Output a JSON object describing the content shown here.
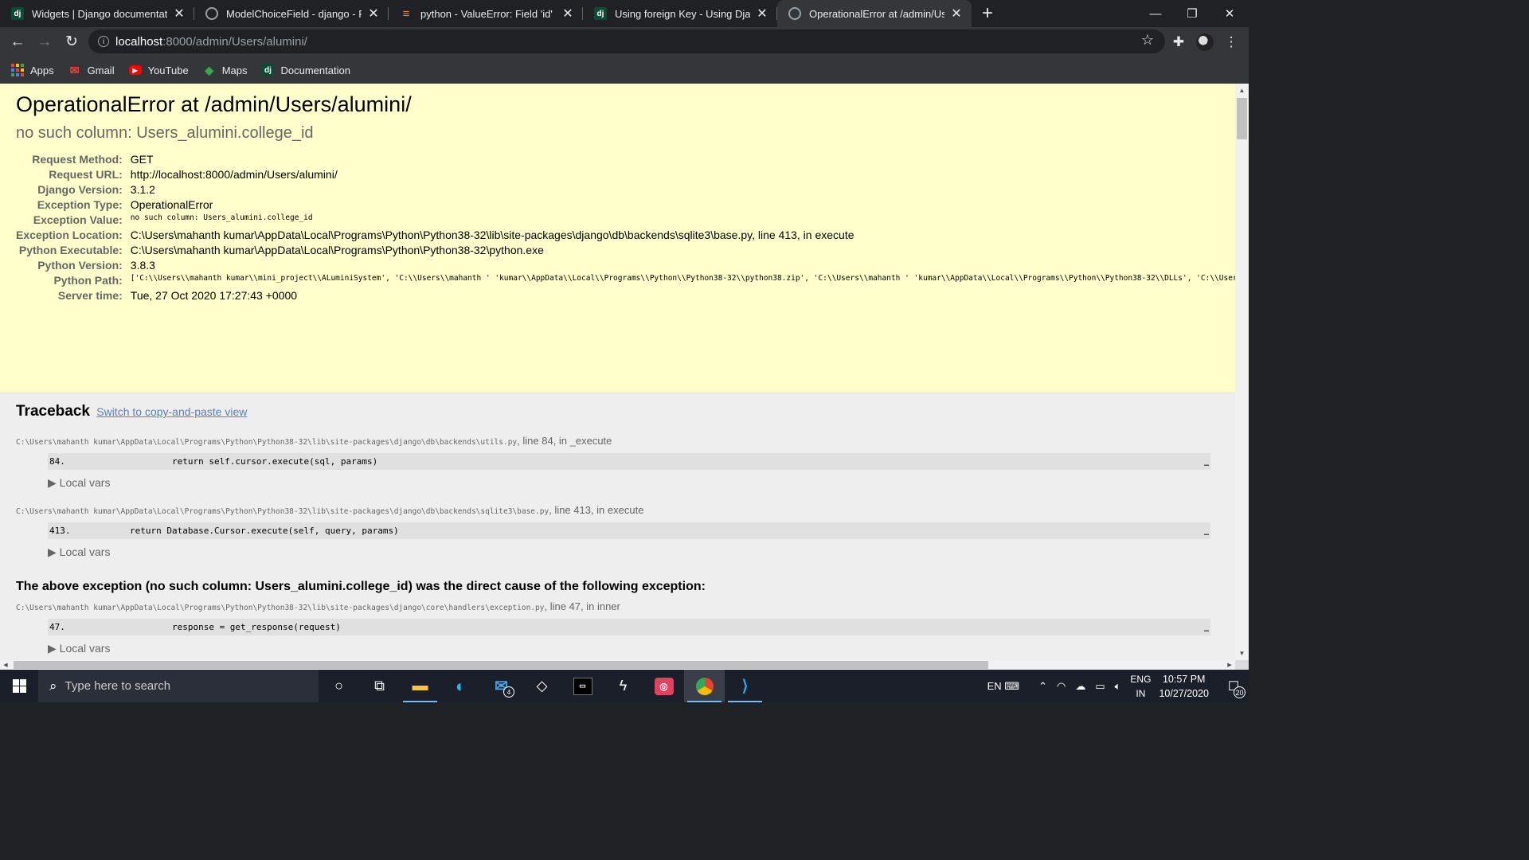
{
  "browser": {
    "tabs": [
      {
        "title": "Widgets | Django documentation",
        "icon": "django-icon"
      },
      {
        "title": "ModelChoiceField - django - Pyth",
        "icon": "globe-icon"
      },
      {
        "title": "python - ValueError: Field 'id' exp",
        "icon": "stackoverflow-icon"
      },
      {
        "title": "Using foreign Key - Using Django",
        "icon": "django-icon"
      },
      {
        "title": "OperationalError at /admin/Users",
        "icon": "globe-icon",
        "active": true
      }
    ],
    "url_host": "localhost",
    "url_path": ":8000/admin/Users/alumini/",
    "bookmarks": [
      "Apps",
      "Gmail",
      "YouTube",
      "Maps",
      "Documentation"
    ]
  },
  "error": {
    "title": "OperationalError at /admin/Users/alumini/",
    "subtitle": "no such column: Users_alumini.college_id",
    "meta": [
      {
        "label": "Request Method:",
        "value": "GET"
      },
      {
        "label": "Request URL:",
        "value": "http://localhost:8000/admin/Users/alumini/"
      },
      {
        "label": "Django Version:",
        "value": "3.1.2"
      },
      {
        "label": "Exception Type:",
        "value": "OperationalError"
      },
      {
        "label": "Exception Value:",
        "value": "no such column: Users_alumini.college_id"
      },
      {
        "label": "Exception Location:",
        "value": "C:\\Users\\mahanth kumar\\AppData\\Local\\Programs\\Python\\Python38-32\\lib\\site-packages\\django\\db\\backends\\sqlite3\\base.py, line 413, in execute"
      },
      {
        "label": "Python Executable:",
        "value": "C:\\Users\\mahanth kumar\\AppData\\Local\\Programs\\Python\\Python38-32\\python.exe"
      },
      {
        "label": "Python Version:",
        "value": "3.8.3"
      },
      {
        "label": "Python Path:",
        "value": "['C:\\\\Users\\\\mahanth kumar\\\\mini_project\\\\ALuminiSystem',\n 'C:\\\\Users\\\\mahanth '\n 'kumar\\\\AppData\\\\Local\\\\Programs\\\\Python\\\\Python38-32\\\\python38.zip',\n 'C:\\\\Users\\\\mahanth '\n 'kumar\\\\AppData\\\\Local\\\\Programs\\\\Python\\\\Python38-32\\\\DLLs',\n 'C:\\\\Users\\\\mahanth kumar\\\\AppData\\\\Local\\\\Programs\\\\Python\\\\Python38-32\\\\lib',\n 'C:\\\\Users\\\\mahanth kumar\\\\AppData\\\\Local\\\\Programs\\\\Python\\\\Python38-32',\n 'C:\\\\Users\\\\mahanth kumar\\\\AppData\\\\Roaming\\\\Python\\\\Python38\\\\site-packages',\n 'C:\\\\Users\\\\mahanth '\n 'kumar\\\\AppData\\\\Local\\\\Programs\\\\Python\\\\Python38-32\\\\lib\\\\site-packages']"
      },
      {
        "label": "Server time:",
        "value": "Tue, 27 Oct 2020 17:27:43 +0000"
      }
    ]
  },
  "traceback": {
    "title": "Traceback",
    "switch_link": "Switch to copy-and-paste view",
    "frames": [
      {
        "file": "C:\\Users\\mahanth kumar\\AppData\\Local\\Programs\\Python\\Python38-32\\lib\\site-packages\\django\\db\\backends\\utils.py",
        "where": ", line 84, in _execute",
        "lineno": "84.",
        "code": "                return self.cursor.execute(sql, params)",
        "ellipsis": "…",
        "localvars": "▶ Local vars"
      },
      {
        "file": "C:\\Users\\mahanth kumar\\AppData\\Local\\Programs\\Python\\Python38-32\\lib\\site-packages\\django\\db\\backends\\sqlite3\\base.py",
        "where": ", line 413, in execute",
        "lineno": "413.",
        "code": "        return Database.Cursor.execute(self, query, params)",
        "ellipsis": "…",
        "localvars": "▶ Local vars"
      }
    ],
    "cause": "The above exception (no such column: Users_alumini.college_id) was the direct cause of the following exception:",
    "frame3": {
      "file": "C:\\Users\\mahanth kumar\\AppData\\Local\\Programs\\Python\\Python38-32\\lib\\site-packages\\django\\core\\handlers\\exception.py",
      "where": ", line 47, in inner",
      "lineno": "47.",
      "code": "                response = get_response(request)",
      "ellipsis": "…",
      "localvars": "▶ Local vars"
    }
  },
  "taskbar": {
    "search_placeholder": "Type here to search",
    "mail_badge": "4",
    "lang_top": "ENG",
    "lang_bottom": "IN",
    "input_label": "EN",
    "time": "10:57 PM",
    "date": "10/27/2020",
    "notif_count": "20"
  }
}
